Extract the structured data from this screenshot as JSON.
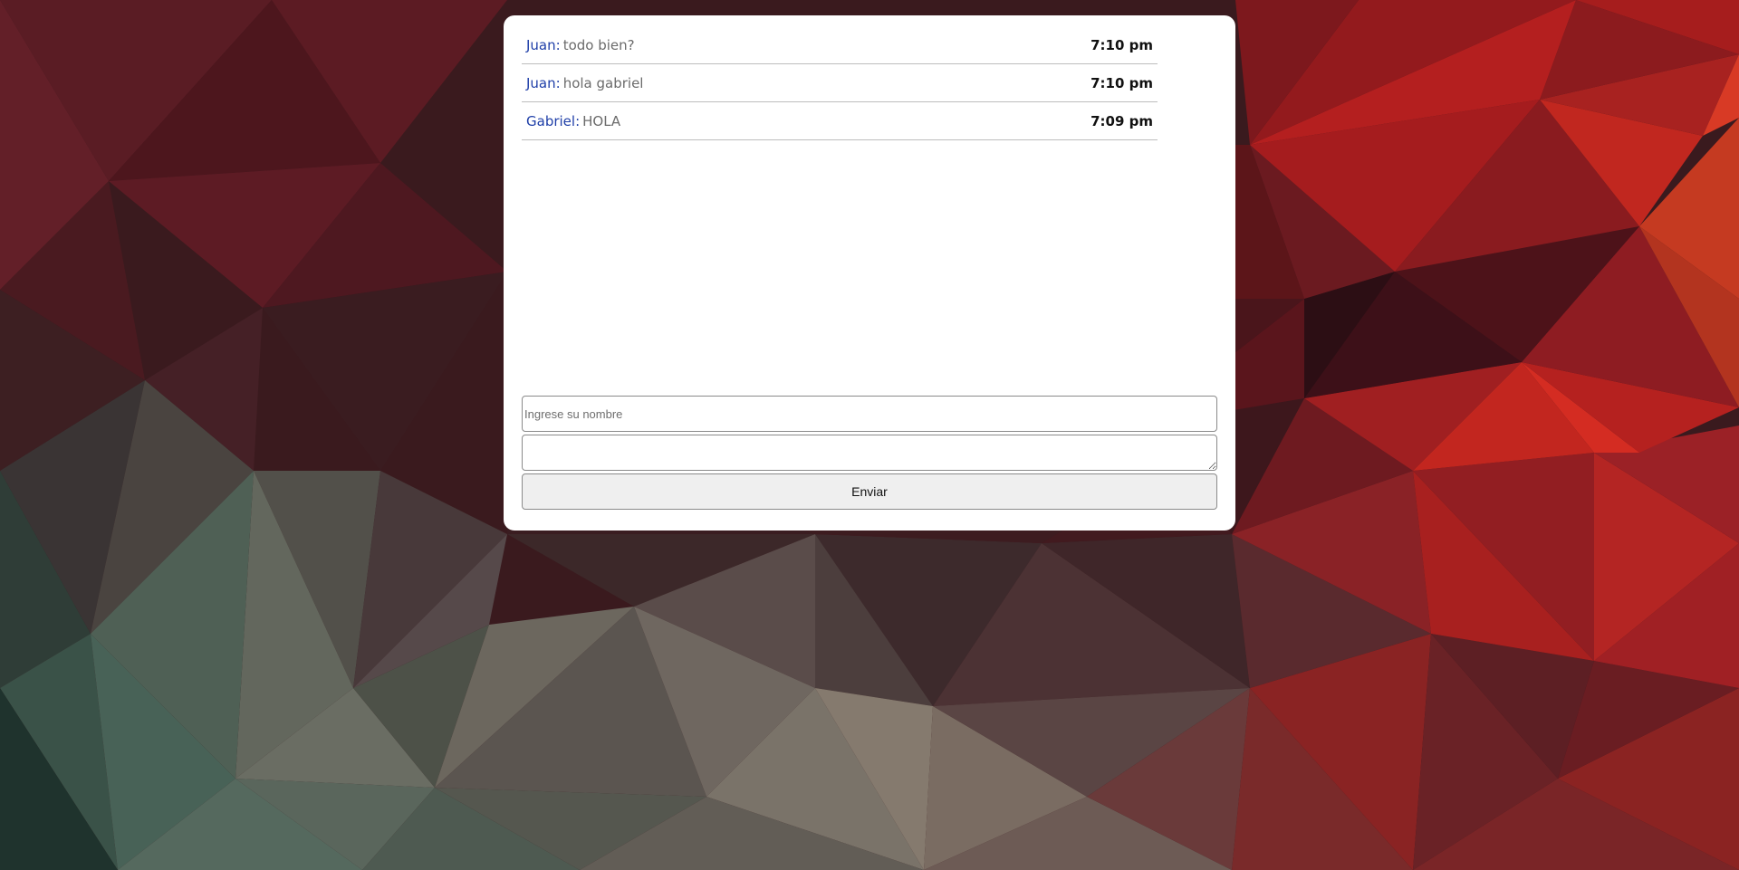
{
  "messages": [
    {
      "sender": "Juan:",
      "text": "todo bien?",
      "time": "7:10 pm"
    },
    {
      "sender": "Juan:",
      "text": "hola gabriel",
      "time": "7:10 pm"
    },
    {
      "sender": "Gabriel:",
      "text": "HOLA",
      "time": "7:09 pm"
    }
  ],
  "form": {
    "name_placeholder": "Ingrese su nombre",
    "name_value": "",
    "message_value": "",
    "send_label": "Enviar"
  },
  "colors": {
    "sender": "#1f3fa8",
    "message_text": "#6b6b6b",
    "card_background": "#ffffff",
    "background_dark": "#3a1a1e",
    "background_red": "#b51f1f",
    "background_green": "#3f5a4f"
  }
}
